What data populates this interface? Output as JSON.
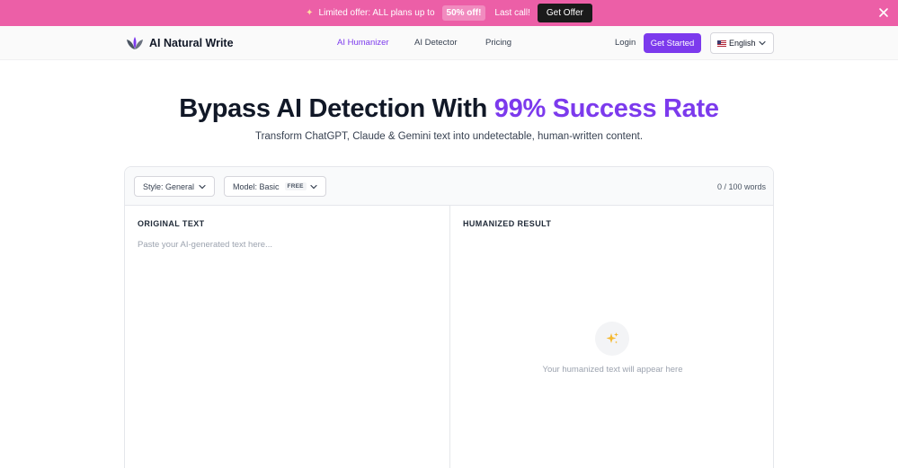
{
  "promo": {
    "offer_text": "Limited offer: ALL plans up to",
    "badge": "50% off!",
    "last_call": "Last call!",
    "button": "Get Offer",
    "background_color": "#ec5fa7"
  },
  "header": {
    "brand": "AI Natural Write",
    "nav": [
      "AI Humanizer",
      "AI Detector",
      "Pricing"
    ],
    "active_nav": "AI Humanizer",
    "login": "Login",
    "cta": "Get Started",
    "language": "English",
    "accent_color": "#7c3aed"
  },
  "hero": {
    "title_main": "Bypass AI Detection With ",
    "title_accent": "99% Success Rate",
    "subtitle": "Transform ChatGPT, Claude & Gemini text into undetectable, human-written content."
  },
  "editor": {
    "style_select": "Style: General",
    "model_select": "Model: Basic",
    "model_badge": "FREE",
    "word_count": "0 / 100 words",
    "original_label": "ORIGINAL TEXT",
    "original_placeholder": "Paste your AI-generated text here...",
    "result_label": "HUMANIZED RESULT",
    "result_empty": "Your humanized text will appear here"
  }
}
